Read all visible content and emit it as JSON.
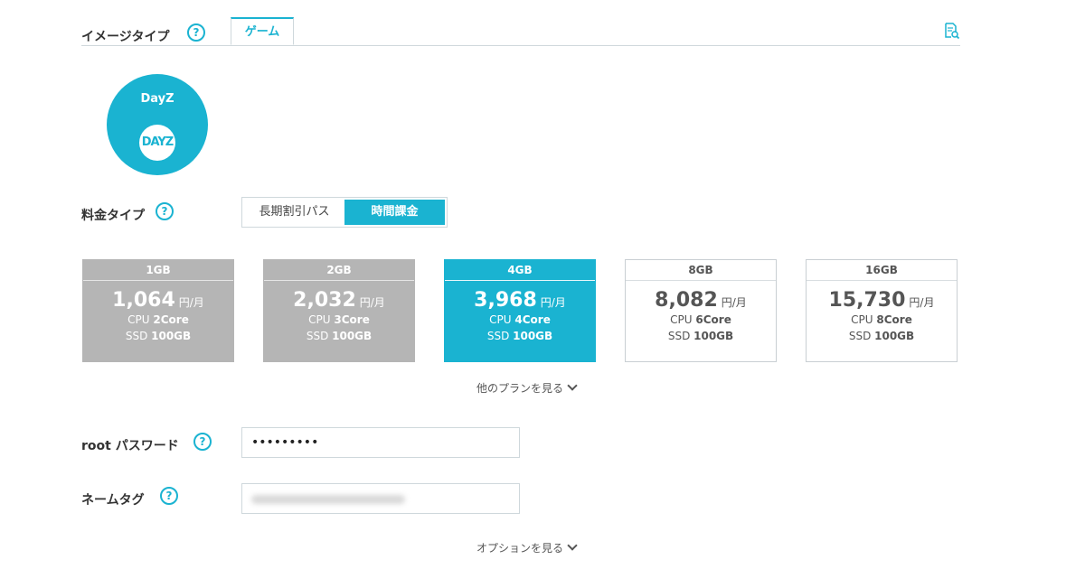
{
  "image_type": {
    "label": "イメージタイプ",
    "help": "?",
    "tab": "ゲーム",
    "doc_icon": "document-search-icon"
  },
  "game": {
    "name": "DayZ",
    "logo_text": "DAYZ"
  },
  "pricing": {
    "label": "料金タイプ",
    "help": "?",
    "options": [
      "長期割引パス",
      "時間課金"
    ],
    "selected": "時間課金"
  },
  "plans": [
    {
      "memory": "1GB",
      "price": "1,064",
      "unit": "円/月",
      "cpu_prefix": "CPU ",
      "cpu": "2Core",
      "ssd_prefix": "SSD ",
      "ssd": "100GB",
      "state": "disabled"
    },
    {
      "memory": "2GB",
      "price": "2,032",
      "unit": "円/月",
      "cpu_prefix": "CPU ",
      "cpu": "3Core",
      "ssd_prefix": "SSD ",
      "ssd": "100GB",
      "state": "disabled"
    },
    {
      "memory": "4GB",
      "price": "3,968",
      "unit": "円/月",
      "cpu_prefix": "CPU ",
      "cpu": "4Core",
      "ssd_prefix": "SSD ",
      "ssd": "100GB",
      "state": "selected"
    },
    {
      "memory": "8GB",
      "price": "8,082",
      "unit": "円/月",
      "cpu_prefix": "CPU ",
      "cpu": "6Core",
      "ssd_prefix": "SSD ",
      "ssd": "100GB",
      "state": "available"
    },
    {
      "memory": "16GB",
      "price": "15,730",
      "unit": "円/月",
      "cpu_prefix": "CPU ",
      "cpu": "8Core",
      "ssd_prefix": "SSD ",
      "ssd": "100GB",
      "state": "available"
    }
  ],
  "more_plans": "他のプランを見る",
  "root_password": {
    "label": "root パスワード",
    "help": "?",
    "value": "•••••••••"
  },
  "name_tag": {
    "label": "ネームタグ",
    "help": "?"
  },
  "more_options": "オプションを見る",
  "colors": {
    "accent": "#1ab3d1",
    "disabled": "#b5b5b5",
    "border": "#cfd8dc"
  }
}
